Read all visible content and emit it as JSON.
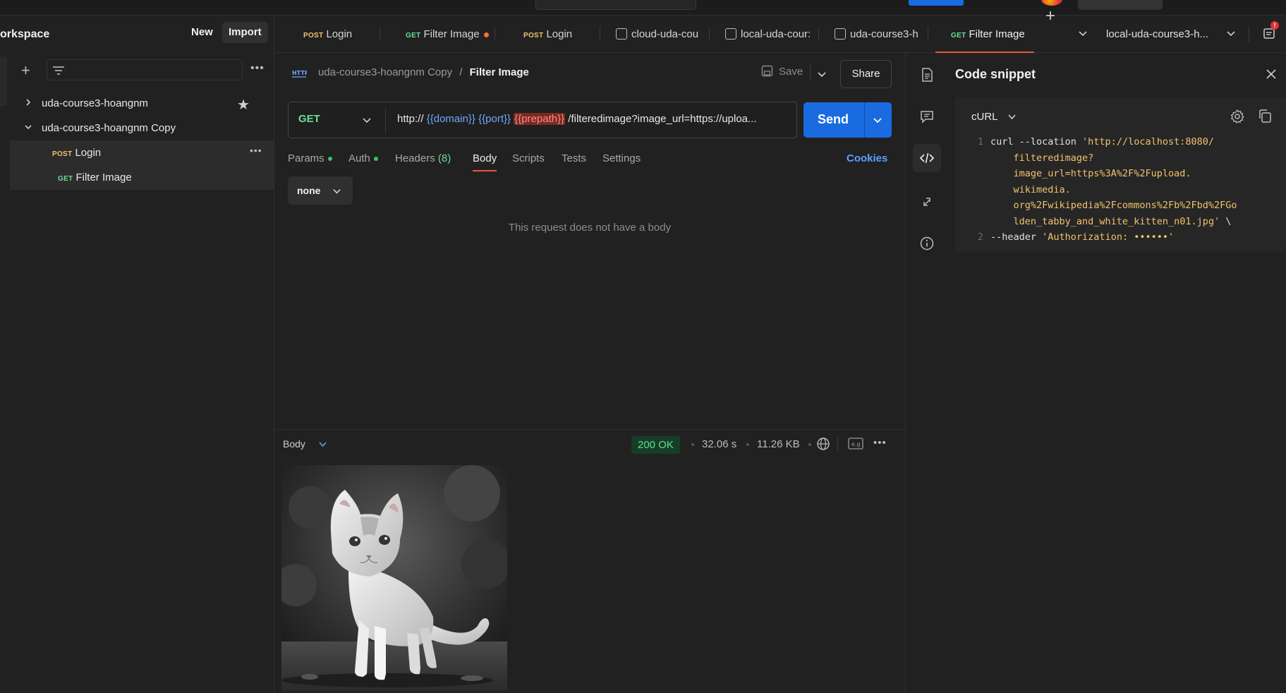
{
  "sidebar": {
    "workspace_title": "orkspace",
    "new_label": "New",
    "import_label": "Import",
    "tree": [
      {
        "label": "uda-course3-hoangnm",
        "expanded": false,
        "starred": true
      },
      {
        "label": "uda-course3-hoangnm Copy",
        "expanded": true
      },
      {
        "method": "POST",
        "label": "Login"
      },
      {
        "method": "GET",
        "label": "Filter Image"
      }
    ]
  },
  "tabs": [
    {
      "method": "POST",
      "label": "Login"
    },
    {
      "method": "GET",
      "label": "Filter Image",
      "unsaved": true
    },
    {
      "method": "POST",
      "label": "Login"
    },
    {
      "icon": "environment-icon",
      "label": "cloud-uda-cou"
    },
    {
      "icon": "environment-icon",
      "label": "local-uda-cour:"
    },
    {
      "icon": "flow-icon",
      "label": "uda-course3-h"
    },
    {
      "method": "GET",
      "label": "Filter Image",
      "active": true
    }
  ],
  "environment": {
    "selected": "local-uda-course3-h..."
  },
  "request": {
    "breadcrumb_parent": "uda-course3-hoangnm Copy",
    "breadcrumb_sep": "/",
    "breadcrumb_current": "Filter Image",
    "save_label": "Save",
    "share_label": "Share",
    "method": "GET",
    "url": {
      "prefix": "http://",
      "domain_var": "{{domain}}",
      "port_var": "{{port}}",
      "prepath_var": "{{prepath}}",
      "suffix": "/filteredimage?image_url=https://uploa..."
    },
    "send_label": "Send",
    "tabs": [
      {
        "label": "Params",
        "dot": true
      },
      {
        "label": "Auth",
        "dot": true
      },
      {
        "label": "Headers",
        "count": "(8)"
      },
      {
        "label": "Body",
        "active": true
      },
      {
        "label": "Scripts"
      },
      {
        "label": "Tests"
      },
      {
        "label": "Settings"
      }
    ],
    "cookies_label": "Cookies",
    "body_type": "none",
    "no_body_text": "This request does not have a body"
  },
  "response": {
    "body_label": "Body",
    "status": "200 OK",
    "time": "32.06 s",
    "size": "11.26 KB"
  },
  "snippet": {
    "title": "Code snippet",
    "language": "cURL",
    "lines": [
      {
        "n": "1",
        "parts": [
          {
            "t": "curl --location ",
            "c": ""
          },
          {
            "t": "'http://localhost:8080/",
            "c": "str"
          }
        ]
      },
      {
        "n": "",
        "parts": [
          {
            "t": "    filteredimage?",
            "c": "str"
          }
        ]
      },
      {
        "n": "",
        "parts": [
          {
            "t": "    image_url=https%3A%2F%2Fupload.",
            "c": "str"
          }
        ]
      },
      {
        "n": "",
        "parts": [
          {
            "t": "    wikimedia.",
            "c": "str"
          }
        ]
      },
      {
        "n": "",
        "parts": [
          {
            "t": "    org%2Fwikipedia%2Fcommons%2Fb%2Fbd%2FGo",
            "c": "str"
          }
        ]
      },
      {
        "n": "",
        "parts": [
          {
            "t": "    lden_tabby_and_white_kitten_n01.jpg' ",
            "c": "str"
          },
          {
            "t": "\\",
            "c": ""
          }
        ]
      },
      {
        "n": "2",
        "parts": [
          {
            "t": "--header ",
            "c": ""
          },
          {
            "t": "'Authorization: ••••••'",
            "c": "str"
          }
        ]
      }
    ]
  },
  "notifications": {
    "badge": "!"
  },
  "colors": {
    "accent": "#e8563a",
    "send": "#1a6be0",
    "get": "#6bdd9a",
    "post": "#f0c36d",
    "var": "#6ea8ff"
  }
}
